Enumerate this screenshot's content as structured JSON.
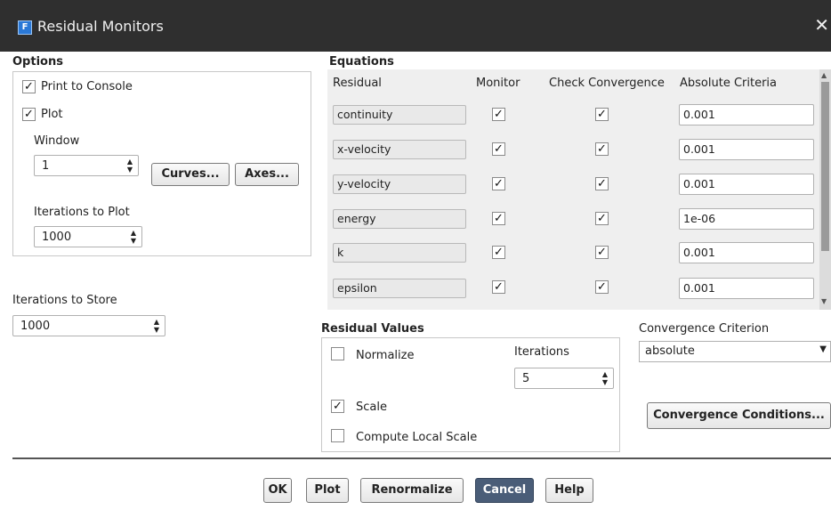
{
  "window": {
    "title": "Residual Monitors",
    "close_glyph": "✕"
  },
  "options": {
    "heading": "Options",
    "print_to_console": {
      "label": "Print to Console",
      "checked": true
    },
    "plot": {
      "label": "Plot",
      "checked": true
    },
    "window_label": "Window",
    "window_value": "1",
    "curves_button": "Curves...",
    "axes_button": "Axes...",
    "iterations_to_plot_label": "Iterations to Plot",
    "iterations_to_plot_value": "1000",
    "iterations_to_store_label": "Iterations to Store",
    "iterations_to_store_value": "1000"
  },
  "equations": {
    "heading": "Equations",
    "columns": [
      "Residual",
      "Monitor",
      "Check Convergence",
      "Absolute Criteria"
    ],
    "rows": [
      {
        "residual": "continuity",
        "monitor": true,
        "check": true,
        "criteria": "0.001"
      },
      {
        "residual": "x-velocity",
        "monitor": true,
        "check": true,
        "criteria": "0.001"
      },
      {
        "residual": "y-velocity",
        "monitor": true,
        "check": true,
        "criteria": "0.001"
      },
      {
        "residual": "energy",
        "monitor": true,
        "check": true,
        "criteria": "1e-06"
      },
      {
        "residual": "k",
        "monitor": true,
        "check": true,
        "criteria": "0.001"
      },
      {
        "residual": "epsilon",
        "monitor": true,
        "check": true,
        "criteria": "0.001"
      }
    ]
  },
  "residual_values": {
    "heading": "Residual Values",
    "normalize": {
      "label": "Normalize",
      "checked": false
    },
    "iterations_label": "Iterations",
    "iterations_value": "5",
    "scale": {
      "label": "Scale",
      "checked": true
    },
    "compute_local_scale": {
      "label": "Compute Local Scale",
      "checked": false
    }
  },
  "convergence": {
    "criterion_label": "Convergence Criterion",
    "criterion_value": "absolute",
    "conditions_button": "Convergence Conditions..."
  },
  "footer": {
    "ok": "OK",
    "plot": "Plot",
    "renormalize": "Renormalize",
    "cancel": "Cancel",
    "help": "Help"
  }
}
